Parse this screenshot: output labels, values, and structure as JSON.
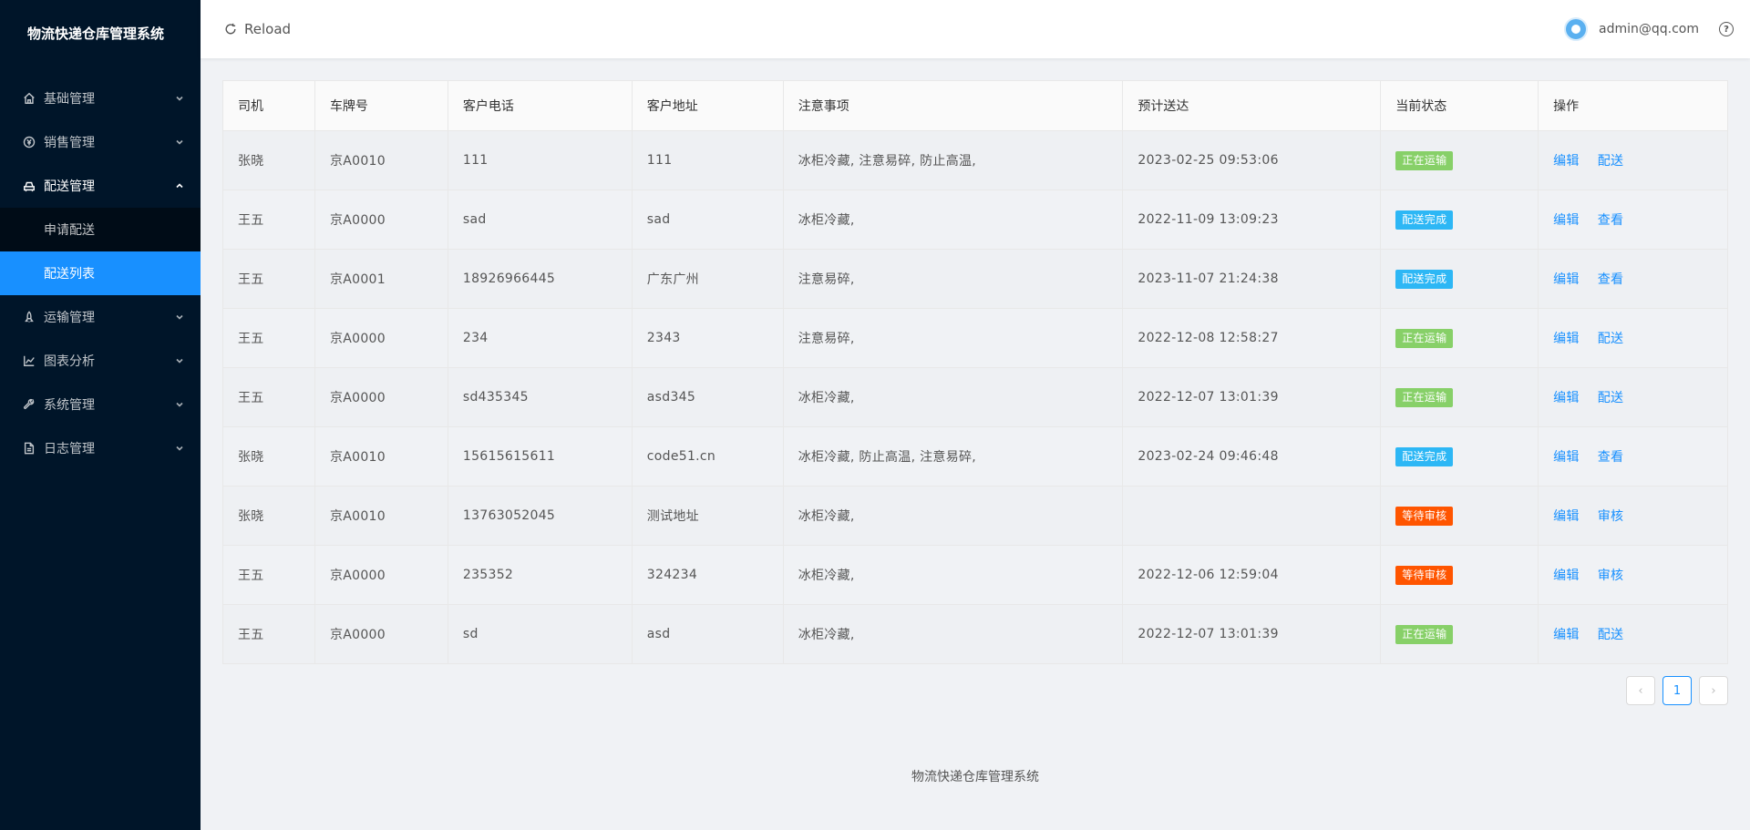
{
  "app": {
    "title": "物流快递仓库管理系统"
  },
  "sidebar": {
    "items": [
      {
        "label": "基础管理",
        "icon": "home-icon"
      },
      {
        "label": "销售管理",
        "icon": "currency-icon"
      },
      {
        "label": "配送管理",
        "icon": "car-icon",
        "open": true,
        "children": [
          {
            "label": "申请配送"
          },
          {
            "label": "配送列表",
            "active": true
          }
        ]
      },
      {
        "label": "运输管理",
        "icon": "rocket-icon"
      },
      {
        "label": "图表分析",
        "icon": "line-chart-icon"
      },
      {
        "label": "系统管理",
        "icon": "tool-icon"
      },
      {
        "label": "日志管理",
        "icon": "file-icon"
      }
    ]
  },
  "header": {
    "reload_label": "Reload",
    "user": "admin@qq.com",
    "help": "?"
  },
  "table": {
    "columns": [
      "司机",
      "车牌号",
      "客户电话",
      "客户地址",
      "注意事项",
      "预计送达",
      "当前状态",
      "操作"
    ],
    "rows": [
      {
        "driver": "张晓",
        "plate": "京A0010",
        "phone": "111",
        "address": "111",
        "note": "冰柜冷藏, 注意易碎, 防止高温,",
        "eta": "2023-02-25 09:53:06",
        "status": "正在运输",
        "status_color": "#87d068",
        "actions": [
          "编辑",
          "配送"
        ]
      },
      {
        "driver": "王五",
        "plate": "京A0000",
        "phone": "sad",
        "address": "sad",
        "note": "冰柜冷藏,",
        "eta": "2022-11-09 13:09:23",
        "status": "配送完成",
        "status_color": "#2db7f5",
        "actions": [
          "编辑",
          "查看"
        ]
      },
      {
        "driver": "王五",
        "plate": "京A0001",
        "phone": "18926966445",
        "address": "广东广州",
        "note": "注意易碎,",
        "eta": "2023-11-07 21:24:38",
        "status": "配送完成",
        "status_color": "#2db7f5",
        "actions": [
          "编辑",
          "查看"
        ]
      },
      {
        "driver": "王五",
        "plate": "京A0000",
        "phone": "234",
        "address": "2343",
        "note": "注意易碎,",
        "eta": "2022-12-08 12:58:27",
        "status": "正在运输",
        "status_color": "#87d068",
        "actions": [
          "编辑",
          "配送"
        ]
      },
      {
        "driver": "王五",
        "plate": "京A0000",
        "phone": "sd435345",
        "address": "asd345",
        "note": "冰柜冷藏,",
        "eta": "2022-12-07 13:01:39",
        "status": "正在运输",
        "status_color": "#87d068",
        "actions": [
          "编辑",
          "配送"
        ]
      },
      {
        "driver": "张晓",
        "plate": "京A0010",
        "phone": "15615615611",
        "address": "code51.cn",
        "note": "冰柜冷藏, 防止高温, 注意易碎,",
        "eta": "2023-02-24 09:46:48",
        "status": "配送完成",
        "status_color": "#2db7f5",
        "actions": [
          "编辑",
          "查看"
        ]
      },
      {
        "driver": "张晓",
        "plate": "京A0010",
        "phone": "13763052045",
        "address": "测试地址",
        "note": "冰柜冷藏,",
        "eta": "",
        "status": "等待审核",
        "status_color": "#f50",
        "actions": [
          "编辑",
          "审核"
        ]
      },
      {
        "driver": "王五",
        "plate": "京A0000",
        "phone": "235352",
        "address": "324234",
        "note": "冰柜冷藏,",
        "eta": "2022-12-06 12:59:04",
        "status": "等待审核",
        "status_color": "#f50",
        "actions": [
          "编辑",
          "审核"
        ]
      },
      {
        "driver": "王五",
        "plate": "京A0000",
        "phone": "sd",
        "address": "asd",
        "note": "冰柜冷藏,",
        "eta": "2022-12-07 13:01:39",
        "status": "正在运输",
        "status_color": "#87d068",
        "actions": [
          "编辑",
          "配送"
        ]
      }
    ]
  },
  "pagination": {
    "prev": "‹",
    "current": "1",
    "next": "›"
  },
  "footer": {
    "text": "物流快递仓库管理系统"
  }
}
